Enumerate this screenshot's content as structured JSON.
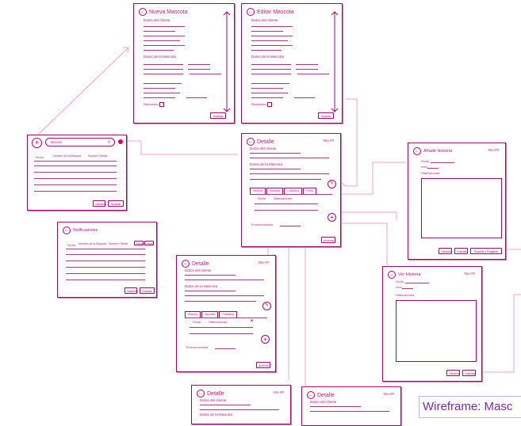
{
  "labels": {
    "nueva_mascota": "Nueva Mascota",
    "editar_mascota": "Editar Mascota",
    "detalle": "Detalle",
    "anadir_historia": "Añadir Historia",
    "ver_historia": "Ver Historia",
    "notificaciones": "Notificaciones",
    "buscar": "Buscar",
    "nro": "Nro ##",
    "datos_cliente": "Datos del cliente",
    "datos_mascota": "Datos de la Mascota",
    "proxima_consulta": "Proxima consulta",
    "guardar": "Guardar",
    "cancelar": "Cancelar",
    "archivar": "Archivar",
    "guardar_y_registrar": "Guardar y Registrar",
    "fecha": "Fecha",
    "hora": "Hora",
    "observaciones": "Observaciones",
    "tab_historia": "Historia",
    "tab_vacunas": "Vacunas",
    "tab_cuidados": "Cuidados",
    "tab_fotos": "Fotos",
    "reproductor": "Reproductor",
    "col_fecha": "Fecha",
    "col_observaciones": "Observaciones",
    "col_nombre": "Nombre de la Mascota",
    "col_nombre_cliente": "Nombre Cliente",
    "caption": "Wireframe: Masc"
  },
  "icons": {
    "back": "back-arrow-icon",
    "add": "plus-icon",
    "edit": "pencil-icon",
    "search": "magnifier-icon",
    "close": "close-icon",
    "notification": "notification-dot-icon"
  },
  "colors": {
    "stroke": "#a8006a",
    "text": "#c4137a",
    "connector": "#f2a2c8",
    "caption": "#7a2aa0"
  }
}
